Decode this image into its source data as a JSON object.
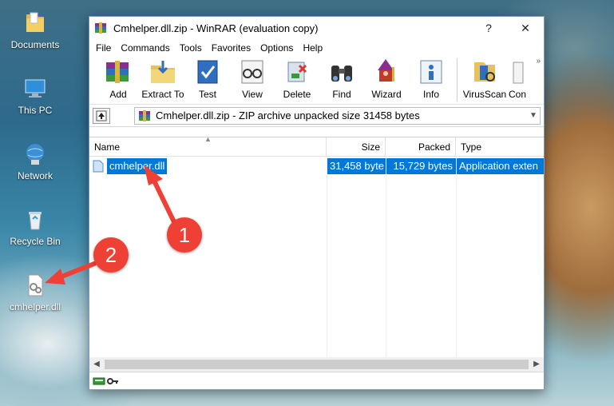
{
  "desktop": {
    "icons": [
      {
        "label": "Documents"
      },
      {
        "label": "This PC"
      },
      {
        "label": "Network"
      },
      {
        "label": "Recycle Bin"
      },
      {
        "label": "cmhelper.dll"
      }
    ]
  },
  "window": {
    "title": "Cmhelper.dll.zip - WinRAR (evaluation copy)",
    "help_label": "?",
    "close_label": "✕"
  },
  "menu": [
    "File",
    "Commands",
    "Tools",
    "Favorites",
    "Options",
    "Help"
  ],
  "toolbar": {
    "buttons": [
      "Add",
      "Extract To",
      "Test",
      "View",
      "Delete",
      "Find",
      "Wizard",
      "Info",
      "VirusScan",
      "Con"
    ],
    "overflow": "»"
  },
  "address": {
    "path": "Cmhelper.dll.zip - ZIP archive unpacked size 31458 bytes"
  },
  "columns": {
    "name": "Name",
    "size": "Size",
    "packed": "Packed",
    "type": "Type"
  },
  "files": [
    {
      "name": "cmhelper.dll",
      "size": "31,458 byte",
      "packed": "15,729 bytes",
      "type": "Application exten"
    }
  ],
  "annotations": {
    "step1": "1",
    "step2": "2"
  },
  "colors": {
    "accent": "#0078d7",
    "badge": "#ee4035"
  }
}
